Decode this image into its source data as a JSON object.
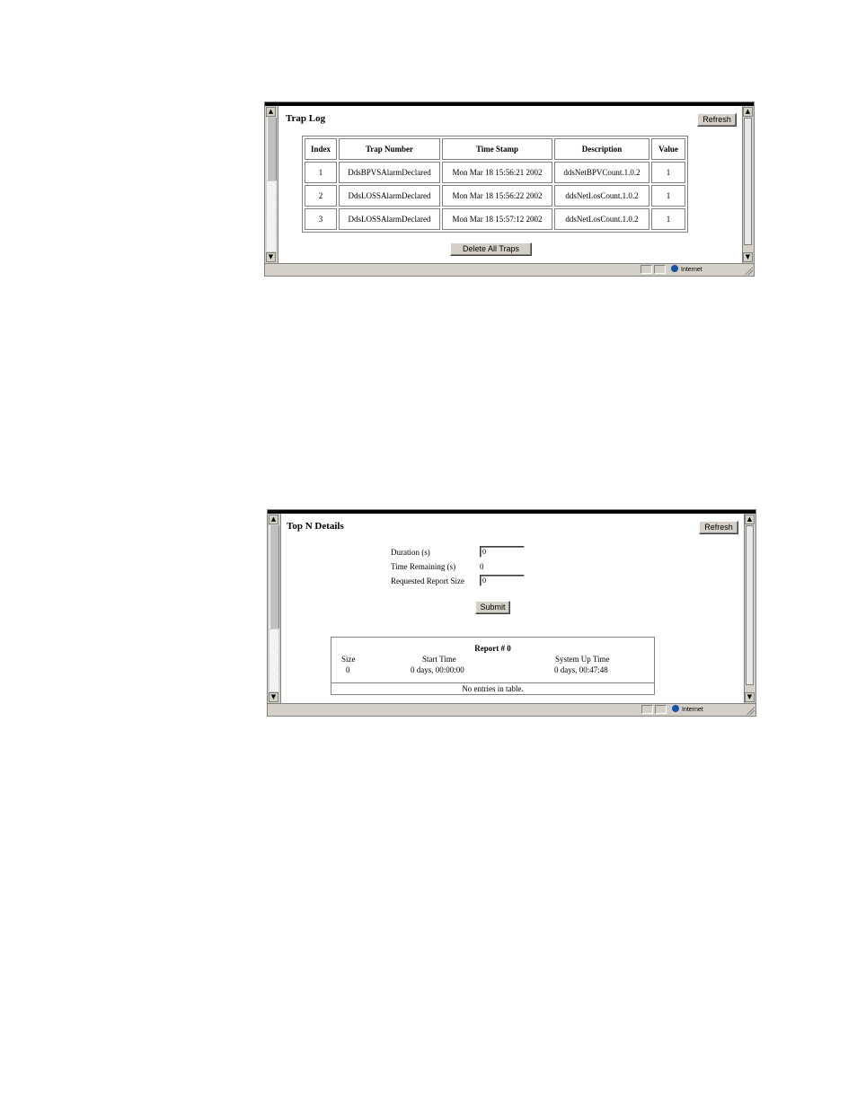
{
  "trap_log": {
    "title": "Trap Log",
    "refresh_label": "Refresh",
    "columns": [
      "Index",
      "Trap Number",
      "Time Stamp",
      "Description",
      "Value"
    ],
    "rows": [
      [
        "1",
        "DdsBPVSAlarmDeclared",
        "Mon Mar 18 15:56:21 2002",
        "ddsNetBPVCount.1.0.2",
        "1"
      ],
      [
        "2",
        "DdsLOSSAlarmDeclared",
        "Mon Mar 18 15:56:22 2002",
        "ddsNetLosCount.1.0.2",
        "1"
      ],
      [
        "3",
        "DdsLOSSAlarmDeclared",
        "Mon Mar 18 15:57:12 2002",
        "ddsNetLosCount.1.0.2",
        "1"
      ]
    ],
    "delete_label": "Delete All Traps",
    "status_zone": "Internet"
  },
  "top_n": {
    "title": "Top N Details",
    "refresh_label": "Refresh",
    "duration_label": "Duration (s)",
    "duration_value": "0",
    "remaining_label": "Time Remaining (s)",
    "remaining_value": "0",
    "report_size_label": "Requested Report Size",
    "report_size_value": "0",
    "submit_label": "Submit",
    "report": {
      "caption": "Report # 0",
      "size_header": "Size",
      "start_header": "Start Time",
      "uptime_header": "System Up Time",
      "size_value": "0",
      "start_value": "0 days, 00:00:00",
      "uptime_value": "0 days, 00:47:48",
      "empty_text": "No entries in table."
    },
    "status_zone": "Internet"
  },
  "icons": [
    "scroll-up-icon",
    "scroll-down-icon",
    "internet-globe-icon",
    "resize-grip-icon"
  ]
}
